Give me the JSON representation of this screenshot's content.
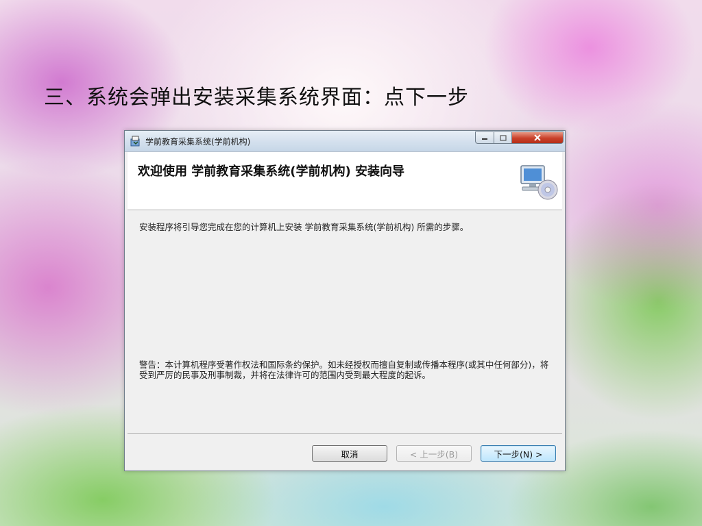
{
  "slide": {
    "heading": "三、系统会弹出安装采集系统界面：点下一步"
  },
  "window": {
    "title": "学前教育采集系统(学前机构)",
    "controls": {
      "minimize_icon": "minimize-icon",
      "maximize_icon": "maximize-icon",
      "close_icon": "close-icon"
    }
  },
  "header": {
    "title": "欢迎使用 学前教育采集系统(学前机构) 安装向导",
    "icon": "computer-disc-icon"
  },
  "body": {
    "intro": "安装程序将引导您完成在您的计算机上安装 学前教育采集系统(学前机构) 所需的步骤。",
    "warning": "警告：本计算机程序受著作权法和国际条约保护。如未经授权而擅自复制或传播本程序(或其中任何部分)，将受到严厉的民事及刑事制裁，并将在法律许可的范围内受到最大程度的起诉。"
  },
  "buttons": {
    "cancel": "取消",
    "back": "< 上一步(B)",
    "next": "下一步(N) >"
  },
  "colors": {
    "close_button": "#c9412a",
    "next_button_border": "#3c7fb1"
  }
}
